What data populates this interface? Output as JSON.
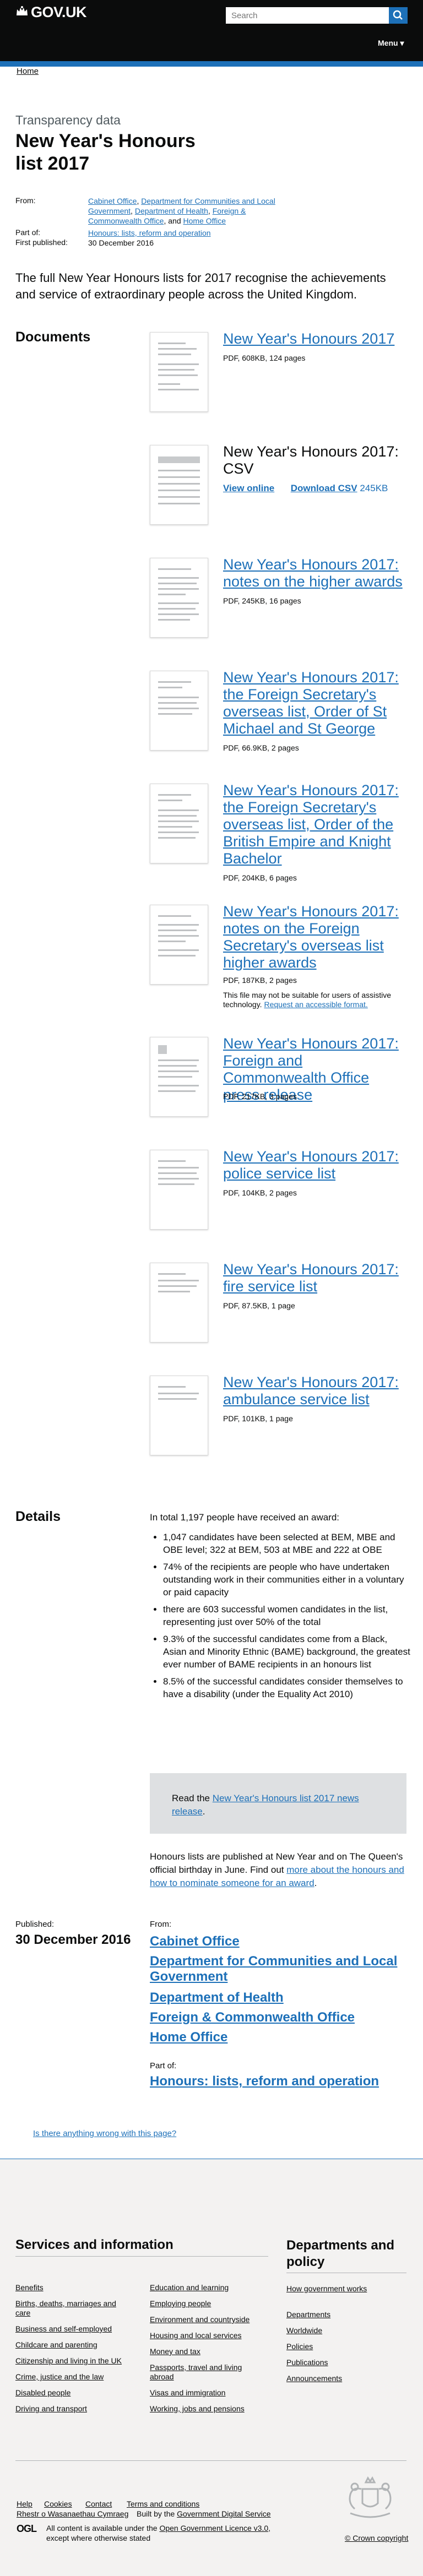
{
  "header": {
    "brand": "GOV.UK",
    "search_placeholder": "Search",
    "menu_label": "Menu ▾"
  },
  "breadcrumb": {
    "home": "Home"
  },
  "title": {
    "caption": "Transparency data",
    "heading": "New Year's Honours list 2017"
  },
  "meta": {
    "from_label": "From:",
    "from_links": [
      "Cabinet Office",
      "Department for Communities and Local Government",
      "Department of Health",
      "Foreign & Commonwealth Office",
      "Home Office"
    ],
    "from_sep_1": ", ",
    "from_sep_and": ", and ",
    "part_of_label": "Part of:",
    "part_of_link": "Honours: lists, reform and operation",
    "first_published_label": "First published:",
    "first_published_value": "30 December 2016"
  },
  "lead": "The full New Year Honours lists for 2017 recognise the achievements and service of extraordinary people across the United Kingdom.",
  "documents_heading": "Documents",
  "documents": [
    {
      "title": "New Year's Honours 2017",
      "meta": "PDF, 608KB, 124 pages"
    },
    {
      "title": "New Year's Honours 2017: CSV",
      "view_online": "View online",
      "download": "Download CSV",
      "size": "245KB"
    },
    {
      "title": "New Year's Honours 2017: notes on the higher awards",
      "meta": "PDF, 245KB, 16 pages"
    },
    {
      "title": "New Year's Honours 2017: the Foreign Secretary's overseas list, Order of St Michael and St George",
      "meta": "PDF, 66.9KB, 2 pages"
    },
    {
      "title": "New Year's Honours 2017: the Foreign Secretary's overseas list, Order of the British Empire and Knight Bachelor",
      "meta": "PDF, 204KB, 6 pages"
    },
    {
      "title": "New Year's Honours 2017: notes on the Foreign Secretary's overseas list higher awards",
      "meta": "PDF, 187KB, 2 pages",
      "note": "This file may not be suitable for users of assistive technology.",
      "note_link": "Request an accessible format."
    },
    {
      "title": "New Year's Honours 2017: Foreign and Commonwealth Office press release",
      "meta": "PDF, 217KB, 3 pages"
    },
    {
      "title": "New Year's Honours 2017: police service list",
      "meta": "PDF, 104KB, 2 pages"
    },
    {
      "title": "New Year's Honours 2017: fire service list",
      "meta": "PDF, 87.5KB, 1 page"
    },
    {
      "title": "New Year's Honours 2017: ambulance service list",
      "meta": "PDF, 101KB, 1 page"
    }
  ],
  "details": {
    "heading": "Details",
    "intro": "In total 1,197 people have received an award:",
    "bullets": [
      "1,047 candidates have been selected at BEM, MBE and OBE level; 322 at BEM, 503 at MBE and 222 at OBE",
      "74% of the recipients are people who have undertaken outstanding work in their communities either in a voluntary or paid capacity",
      "there are 603 successful women candidates in the list, representing just over 50% of the total",
      "9.3% of the successful candidates come from a Black, Asian and Minority Ethnic (BAME) background, the greatest ever number of BAME recipients in an honours list",
      "8.5% of the successful candidates consider themselves to have a disability (under the Equality Act 2010)"
    ],
    "callout_prefix": "Read the ",
    "callout_link": "New Year's Honours list 2017 news release",
    "callout_suffix": ".",
    "outro_prefix": "Honours lists are published at New Year and on The Queen's official birthday in June. Find out ",
    "outro_link": "more about the honours and how to nominate someone for an award",
    "outro_suffix": "."
  },
  "published": {
    "label": "Published:",
    "date": "30 December 2016",
    "from_label": "From:",
    "from_links": [
      "Cabinet Office",
      "Department for Communities and Local Government",
      "Department of Health",
      "Foreign & Commonwealth Office",
      "Home Office"
    ],
    "part_of_label": "Part of:",
    "part_of_link": "Honours: lists, reform and operation"
  },
  "report_link": "Is there anything wrong with this page?",
  "footer": {
    "services_heading": "Services and information",
    "services_col1": [
      "Benefits",
      "Births, deaths, marriages and care",
      "Business and self-employed",
      "Childcare and parenting",
      "Citizenship and living in the UK",
      "Crime, justice and the law",
      "Disabled people",
      "Driving and transport"
    ],
    "services_col2": [
      "Education and learning",
      "Employing people",
      "Environment and countryside",
      "Housing and local services",
      "Money and tax",
      "Passports, travel and living abroad",
      "Visas and immigration",
      "Working, jobs and pensions"
    ],
    "departments_heading": "Departments and policy",
    "departments_links": [
      "How government works",
      "Departments",
      "Worldwide",
      "Policies",
      "Publications",
      "Announcements"
    ],
    "meta_links": [
      "Help",
      "Cookies",
      "Contact",
      "Terms and conditions"
    ],
    "welsh_link": "Rhestr o Wasanaethau Cymraeg",
    "built_by_prefix": "Built by the ",
    "built_by_link": "Government Digital Service",
    "ogl": "OGL",
    "licence_prefix": "All content is available under the ",
    "licence_link": "Open Government Licence v3.0",
    "licence_suffix": ", except where otherwise stated",
    "copyright": "© Crown copyright"
  }
}
